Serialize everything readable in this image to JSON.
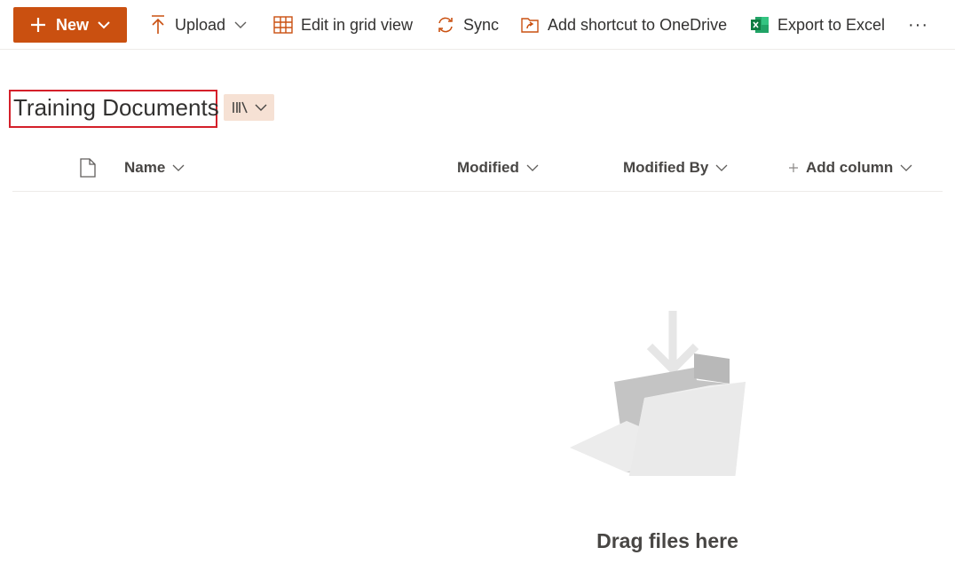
{
  "toolbar": {
    "new_label": "New",
    "upload_label": "Upload",
    "edit_grid_label": "Edit in grid view",
    "sync_label": "Sync",
    "shortcut_label": "Add shortcut to OneDrive",
    "export_label": "Export to Excel",
    "more_label": "···"
  },
  "library": {
    "title": "Training Documents"
  },
  "columns": {
    "name": "Name",
    "modified": "Modified",
    "modified_by": "Modified By",
    "add_column": "Add column"
  },
  "empty_state": {
    "text": "Drag files here"
  },
  "colors": {
    "accent": "#ca5010",
    "accent_light": "#f6e1d4",
    "highlight_box": "#d4202a",
    "excel_green": "#107c41"
  },
  "icons": [
    "plus-icon",
    "upload-icon",
    "grid-icon",
    "sync-icon",
    "shortcut-icon",
    "excel-icon",
    "library-icon",
    "file-icon",
    "chevron-down-icon"
  ]
}
